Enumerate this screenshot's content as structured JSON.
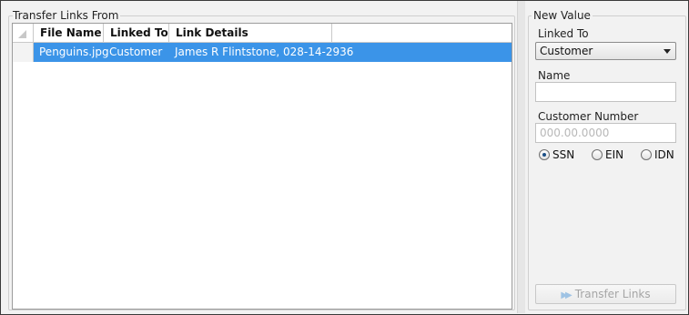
{
  "transfer_from": {
    "title": "Transfer Links From",
    "columns": [
      "File Name",
      "Linked To",
      "Link Details"
    ],
    "rows": [
      {
        "file_name": "Penguins.jpg",
        "linked_to": "Customer",
        "link_details": "James R Flintstone, 028-14-2936",
        "selected": true
      }
    ]
  },
  "new_value": {
    "title": "New Value",
    "linked_to_label": "Linked To",
    "linked_to_value": "Customer",
    "name_label": "Name",
    "name_value": "",
    "customer_number_label": "Customer Number",
    "customer_number_placeholder": "000.00.0000",
    "id_types": [
      {
        "label": "SSN",
        "checked": true
      },
      {
        "label": "EIN",
        "checked": false
      },
      {
        "label": "IDN",
        "checked": false
      }
    ],
    "transfer_button": "Transfer Links",
    "transfer_button_icon": "transfer-arrow-icon"
  },
  "colors": {
    "selection": "#3b94e8",
    "panel_background": "#f2f2f2",
    "disabled_text": "#a5a5a5"
  }
}
